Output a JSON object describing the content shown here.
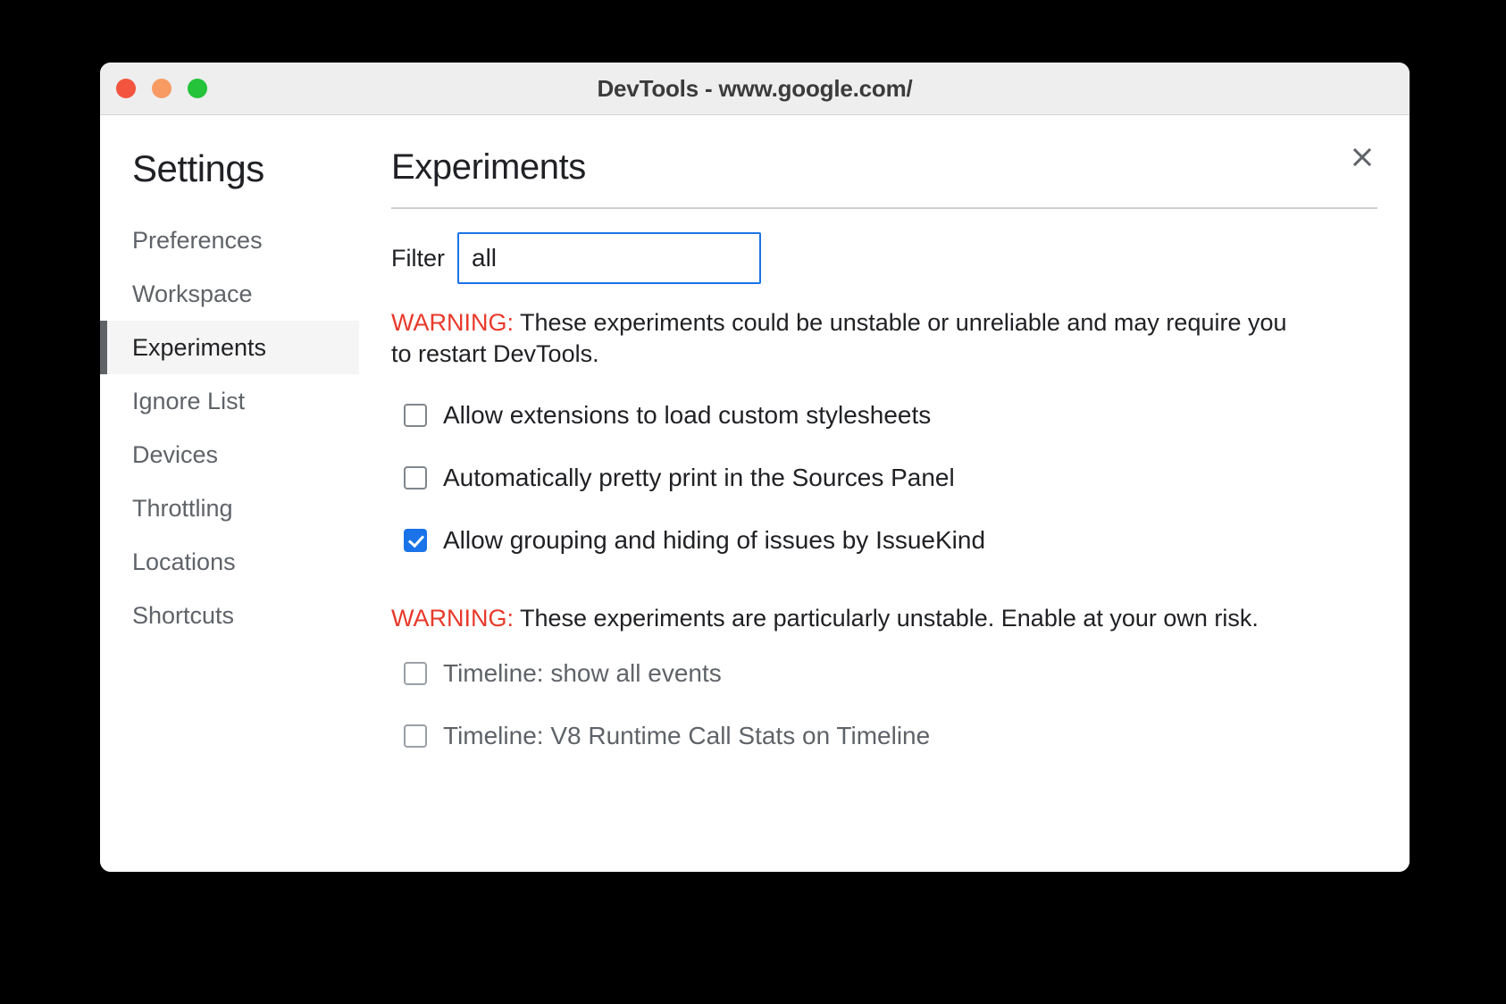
{
  "window": {
    "title": "DevTools - www.google.com/",
    "traffic_lights": [
      {
        "name": "close",
        "color": "#f2543d"
      },
      {
        "name": "minimize",
        "color": "#f89b63"
      },
      {
        "name": "maximize",
        "color": "#25c33a"
      }
    ]
  },
  "dialog": {
    "close_icon": "close-icon"
  },
  "sidebar": {
    "title": "Settings",
    "items": [
      {
        "label": "Preferences",
        "selected": false
      },
      {
        "label": "Workspace",
        "selected": false
      },
      {
        "label": "Experiments",
        "selected": true
      },
      {
        "label": "Ignore List",
        "selected": false
      },
      {
        "label": "Devices",
        "selected": false
      },
      {
        "label": "Throttling",
        "selected": false
      },
      {
        "label": "Locations",
        "selected": false
      },
      {
        "label": "Shortcuts",
        "selected": false
      }
    ]
  },
  "main": {
    "title": "Experiments",
    "filter": {
      "label": "Filter",
      "value": "all",
      "placeholder": "Filter"
    },
    "warning_1": {
      "keyword": "WARNING:",
      "text": " These experiments could be unstable or unreliable and may require you to restart DevTools."
    },
    "warning_2": {
      "keyword": "WARNING:",
      "text": " These experiments are particularly unstable. Enable at your own risk."
    },
    "experiments": [
      {
        "label": "Allow extensions to load custom stylesheets",
        "checked": false
      },
      {
        "label": "Automatically pretty print in the Sources Panel",
        "checked": false
      },
      {
        "label": "Allow grouping and hiding of issues by IssueKind",
        "checked": true
      }
    ],
    "unstable_experiments": [
      {
        "label": "Timeline: show all events",
        "checked": false
      },
      {
        "label": "Timeline: V8 Runtime Call Stats on Timeline",
        "checked": false
      }
    ]
  },
  "colors": {
    "accent": "#1a73e8",
    "warning": "#e8392b",
    "titlebar": "#eeeeee",
    "selected_row": "#f5f5f5"
  }
}
